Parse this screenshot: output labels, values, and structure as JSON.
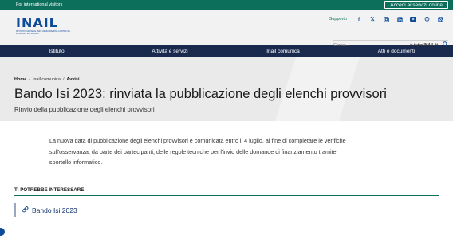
{
  "topbar": {
    "international_label": "For international visitors",
    "access_button": "Accedi ai servizi online"
  },
  "header": {
    "logo_word": "INAIL",
    "logo_sub": "ISTITUTO NAZIONALE PER L'ASSICURAZIONE CONTRO GLI INFORTUNI SUL LAVORO",
    "support_label": "Supporto",
    "social_icons": [
      "facebook-icon",
      "x-icon",
      "instagram-icon",
      "linkedin-icon",
      "youtube-icon",
      "podcast-icon",
      "rss-icon"
    ],
    "search": {
      "placeholder": "Cerca...",
      "scope_prefix": "in",
      "scope_value": "tutto INAIL.it"
    }
  },
  "nav": {
    "items": [
      "Istituto",
      "Attività e servizi",
      "Inail comunica",
      "Atti e documenti"
    ]
  },
  "breadcrumb": {
    "home": "Home",
    "section": "Inail comunica",
    "current": "Avvisi"
  },
  "page": {
    "title": "Bando Isi 2023: rinviata la pubblicazione degli elenchi provvisori",
    "subtitle": "Rinvio della pubblicazione degli elenchi provvisori",
    "body": "La nuova data di pubblicazione degli elenchi provvisori è comunicata entro il 4 luglio, al fine di completare le verifiche sull'osservanza, da parte dei partecipanti, delle regole tecniche per l'invio delle domande di finanziamento tramite sportello informatico."
  },
  "related": {
    "heading": "TI POTREBBE INTERESSARE",
    "links": [
      "Bando Isi 2023"
    ]
  },
  "colors": {
    "topbar": "#0b6f5c",
    "nav": "#1a2a4e",
    "brand_blue": "#0d4a97",
    "hero_bg": "#eaeaea"
  }
}
